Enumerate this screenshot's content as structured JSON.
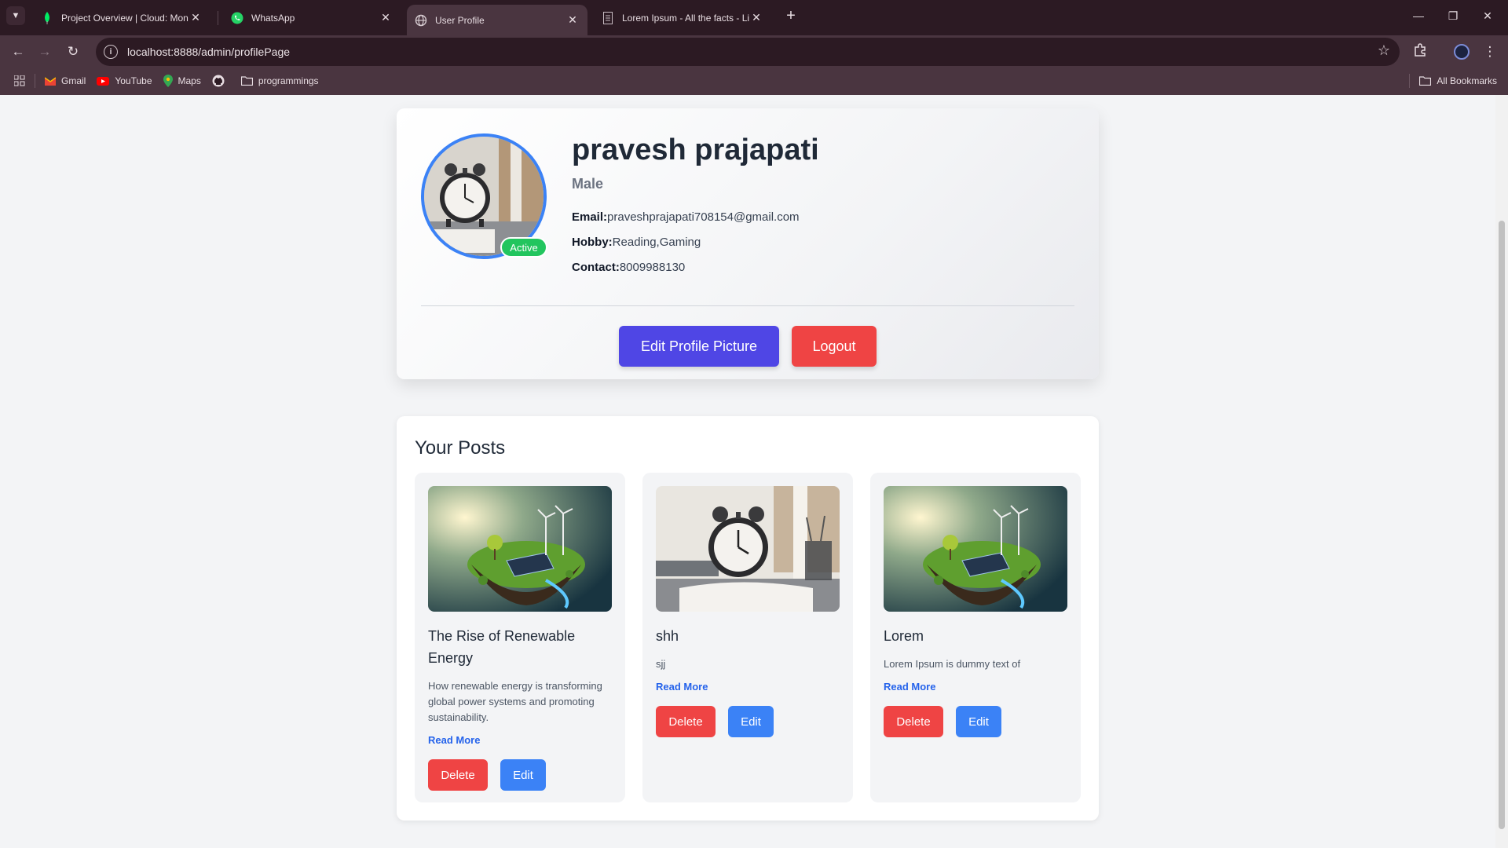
{
  "browser": {
    "tabs": [
      {
        "title": "Project Overview | Cloud: Mong",
        "icon": "mongodb-leaf-icon",
        "active": false
      },
      {
        "title": "WhatsApp",
        "icon": "whatsapp-icon",
        "active": false
      },
      {
        "title": "User Profile",
        "icon": "globe-icon",
        "active": true
      },
      {
        "title": "Lorem Ipsum - All the facts - Lip",
        "icon": "document-icon",
        "active": false
      }
    ],
    "url": "localhost:8888/admin/profilePage",
    "bookmarks": [
      {
        "label": "Gmail",
        "icon": "gmail-icon"
      },
      {
        "label": "YouTube",
        "icon": "youtube-icon"
      },
      {
        "label": "Maps",
        "icon": "maps-icon"
      },
      {
        "label": "",
        "icon": "github-icon"
      },
      {
        "label": "programmings",
        "icon": "folder-icon"
      }
    ],
    "all_bookmarks": "All Bookmarks"
  },
  "profile": {
    "name": "pravesh prajapati",
    "gender": "Male",
    "status": "Active",
    "email_label": "Email:",
    "email": "praveshprajapati708154@gmail.com",
    "hobby_label": "Hobby:",
    "hobby": "Reading,Gaming",
    "contact_label": "Contact:",
    "contact": "8009988130",
    "edit_picture_label": "Edit Profile Picture",
    "logout_label": "Logout"
  },
  "posts": {
    "heading": "Your Posts",
    "read_more_label": "Read More",
    "delete_label": "Delete",
    "edit_label": "Edit",
    "items": [
      {
        "title": "The Rise of Renewable Energy",
        "description": "How renewable energy is transforming global power systems and promoting sustainability.",
        "image": "renewable-energy-image"
      },
      {
        "title": "shh",
        "description": "sjj",
        "image": "alarm-clock-image"
      },
      {
        "title": "Lorem",
        "description": "Lorem Ipsum is dummy text of",
        "image": "renewable-energy-image"
      }
    ]
  },
  "colors": {
    "accent_indigo": "#4f46e5",
    "danger_red": "#ef4444",
    "primary_blue": "#3b82f6",
    "active_green": "#22c55e",
    "chrome_dark": "#2c1a23",
    "chrome_toolbar": "#4a3540"
  }
}
